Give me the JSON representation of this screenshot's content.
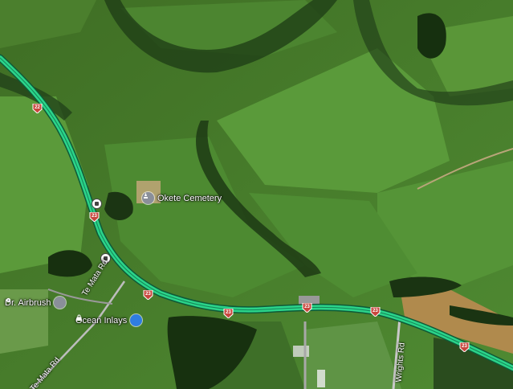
{
  "map": {
    "kind": "satellite",
    "road_color": "#22d185"
  },
  "road_shields": [
    {
      "id": "s1",
      "label": "22",
      "color": "#c8473e"
    },
    {
      "id": "s2",
      "label": "23",
      "color": "#c8473e"
    },
    {
      "id": "s3",
      "label": "23",
      "color": "#c8473e"
    },
    {
      "id": "s4",
      "label": "23",
      "color": "#c8473e"
    },
    {
      "id": "s5",
      "label": "23",
      "color": "#c8473e"
    },
    {
      "id": "s6",
      "label": "23",
      "color": "#c8473e"
    },
    {
      "id": "s7",
      "label": "23",
      "color": "#c8473e"
    }
  ],
  "places": [
    {
      "name": "Okete Cemetery",
      "icon": "cemetery-icon",
      "color": "#8a8f99"
    },
    {
      "name": "Dr. Airbrush",
      "icon": "map-pin-icon",
      "color": "#8a8f99"
    },
    {
      "name": "Ocean Inlays",
      "icon": "shopping-bag-icon",
      "color": "#2f7de1"
    }
  ],
  "roads": [
    {
      "name": "Te Mata Rd"
    },
    {
      "name": "Te Mata Rd"
    },
    {
      "name": "Wrights Rd"
    }
  ],
  "transit": [
    {
      "icon": "bus-stop-icon"
    },
    {
      "icon": "bus-stop-icon"
    }
  ]
}
